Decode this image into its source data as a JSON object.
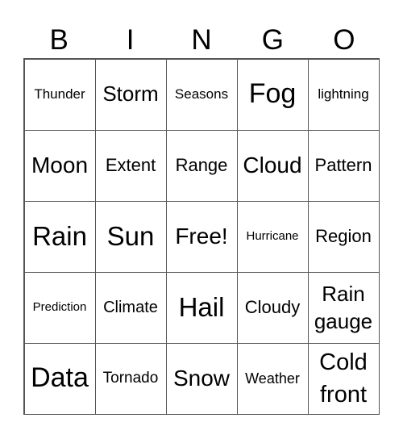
{
  "header": [
    "B",
    "I",
    "N",
    "G",
    "O"
  ],
  "cells": [
    [
      "Thunder",
      "Storm",
      "Seasons",
      "Fog",
      "lightning"
    ],
    [
      "Moon",
      "Extent",
      "Range",
      "Cloud",
      "Pattern"
    ],
    [
      "Rain",
      "Sun",
      "Free!",
      "Hurricane",
      "Region"
    ],
    [
      "Prediction",
      "Climate",
      "Hail",
      "Cloudy",
      "Rain gauge"
    ],
    [
      "Data",
      "Tornado",
      "Snow",
      "Weather",
      "Cold front"
    ]
  ]
}
